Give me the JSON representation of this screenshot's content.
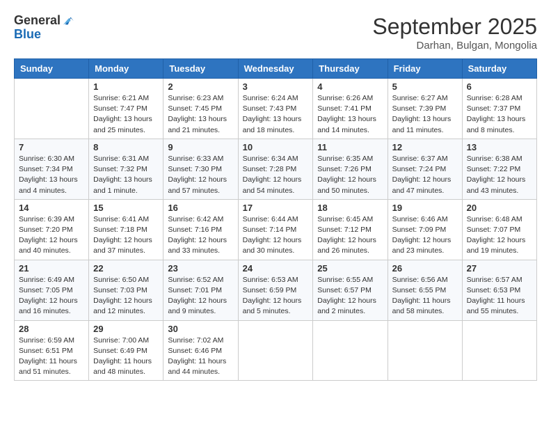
{
  "logo": {
    "general": "General",
    "blue": "Blue"
  },
  "title": "September 2025",
  "subtitle": "Darhan, Bulgan, Mongolia",
  "days_of_week": [
    "Sunday",
    "Monday",
    "Tuesday",
    "Wednesday",
    "Thursday",
    "Friday",
    "Saturday"
  ],
  "weeks": [
    [
      {
        "day": "",
        "info": ""
      },
      {
        "day": "1",
        "info": "Sunrise: 6:21 AM\nSunset: 7:47 PM\nDaylight: 13 hours\nand 25 minutes."
      },
      {
        "day": "2",
        "info": "Sunrise: 6:23 AM\nSunset: 7:45 PM\nDaylight: 13 hours\nand 21 minutes."
      },
      {
        "day": "3",
        "info": "Sunrise: 6:24 AM\nSunset: 7:43 PM\nDaylight: 13 hours\nand 18 minutes."
      },
      {
        "day": "4",
        "info": "Sunrise: 6:26 AM\nSunset: 7:41 PM\nDaylight: 13 hours\nand 14 minutes."
      },
      {
        "day": "5",
        "info": "Sunrise: 6:27 AM\nSunset: 7:39 PM\nDaylight: 13 hours\nand 11 minutes."
      },
      {
        "day": "6",
        "info": "Sunrise: 6:28 AM\nSunset: 7:37 PM\nDaylight: 13 hours\nand 8 minutes."
      }
    ],
    [
      {
        "day": "7",
        "info": "Sunrise: 6:30 AM\nSunset: 7:34 PM\nDaylight: 13 hours\nand 4 minutes."
      },
      {
        "day": "8",
        "info": "Sunrise: 6:31 AM\nSunset: 7:32 PM\nDaylight: 13 hours\nand 1 minute."
      },
      {
        "day": "9",
        "info": "Sunrise: 6:33 AM\nSunset: 7:30 PM\nDaylight: 12 hours\nand 57 minutes."
      },
      {
        "day": "10",
        "info": "Sunrise: 6:34 AM\nSunset: 7:28 PM\nDaylight: 12 hours\nand 54 minutes."
      },
      {
        "day": "11",
        "info": "Sunrise: 6:35 AM\nSunset: 7:26 PM\nDaylight: 12 hours\nand 50 minutes."
      },
      {
        "day": "12",
        "info": "Sunrise: 6:37 AM\nSunset: 7:24 PM\nDaylight: 12 hours\nand 47 minutes."
      },
      {
        "day": "13",
        "info": "Sunrise: 6:38 AM\nSunset: 7:22 PM\nDaylight: 12 hours\nand 43 minutes."
      }
    ],
    [
      {
        "day": "14",
        "info": "Sunrise: 6:39 AM\nSunset: 7:20 PM\nDaylight: 12 hours\nand 40 minutes."
      },
      {
        "day": "15",
        "info": "Sunrise: 6:41 AM\nSunset: 7:18 PM\nDaylight: 12 hours\nand 37 minutes."
      },
      {
        "day": "16",
        "info": "Sunrise: 6:42 AM\nSunset: 7:16 PM\nDaylight: 12 hours\nand 33 minutes."
      },
      {
        "day": "17",
        "info": "Sunrise: 6:44 AM\nSunset: 7:14 PM\nDaylight: 12 hours\nand 30 minutes."
      },
      {
        "day": "18",
        "info": "Sunrise: 6:45 AM\nSunset: 7:12 PM\nDaylight: 12 hours\nand 26 minutes."
      },
      {
        "day": "19",
        "info": "Sunrise: 6:46 AM\nSunset: 7:09 PM\nDaylight: 12 hours\nand 23 minutes."
      },
      {
        "day": "20",
        "info": "Sunrise: 6:48 AM\nSunset: 7:07 PM\nDaylight: 12 hours\nand 19 minutes."
      }
    ],
    [
      {
        "day": "21",
        "info": "Sunrise: 6:49 AM\nSunset: 7:05 PM\nDaylight: 12 hours\nand 16 minutes."
      },
      {
        "day": "22",
        "info": "Sunrise: 6:50 AM\nSunset: 7:03 PM\nDaylight: 12 hours\nand 12 minutes."
      },
      {
        "day": "23",
        "info": "Sunrise: 6:52 AM\nSunset: 7:01 PM\nDaylight: 12 hours\nand 9 minutes."
      },
      {
        "day": "24",
        "info": "Sunrise: 6:53 AM\nSunset: 6:59 PM\nDaylight: 12 hours\nand 5 minutes."
      },
      {
        "day": "25",
        "info": "Sunrise: 6:55 AM\nSunset: 6:57 PM\nDaylight: 12 hours\nand 2 minutes."
      },
      {
        "day": "26",
        "info": "Sunrise: 6:56 AM\nSunset: 6:55 PM\nDaylight: 11 hours\nand 58 minutes."
      },
      {
        "day": "27",
        "info": "Sunrise: 6:57 AM\nSunset: 6:53 PM\nDaylight: 11 hours\nand 55 minutes."
      }
    ],
    [
      {
        "day": "28",
        "info": "Sunrise: 6:59 AM\nSunset: 6:51 PM\nDaylight: 11 hours\nand 51 minutes."
      },
      {
        "day": "29",
        "info": "Sunrise: 7:00 AM\nSunset: 6:49 PM\nDaylight: 11 hours\nand 48 minutes."
      },
      {
        "day": "30",
        "info": "Sunrise: 7:02 AM\nSunset: 6:46 PM\nDaylight: 11 hours\nand 44 minutes."
      },
      {
        "day": "",
        "info": ""
      },
      {
        "day": "",
        "info": ""
      },
      {
        "day": "",
        "info": ""
      },
      {
        "day": "",
        "info": ""
      }
    ]
  ]
}
